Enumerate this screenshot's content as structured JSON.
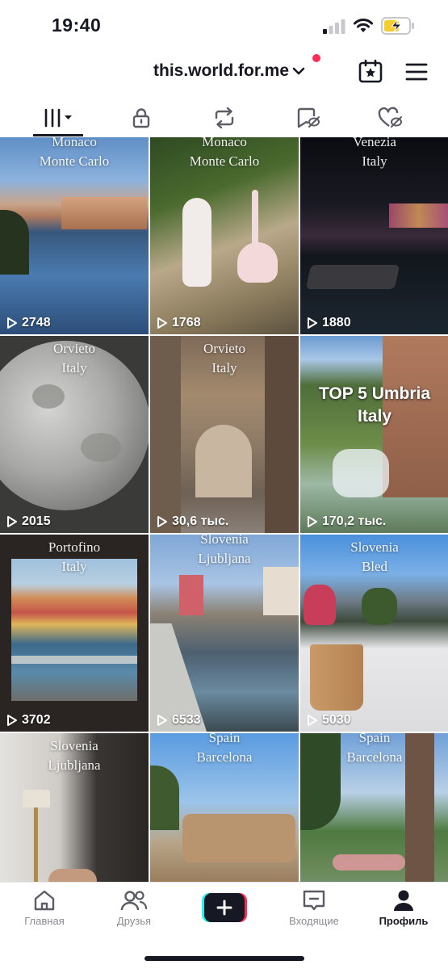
{
  "status_bar": {
    "time": "19:40"
  },
  "header": {
    "username": "this.world.for.me",
    "icons": [
      "chevron-down-icon",
      "calendar-star-icon",
      "hamburger-menu-icon"
    ],
    "accent_color": "#fe2c55"
  },
  "tabs": [
    {
      "name": "videos-grid",
      "icon": "grid-icon",
      "active": true
    },
    {
      "name": "private",
      "icon": "lock-icon",
      "active": false
    },
    {
      "name": "reposts",
      "icon": "repost-icon",
      "active": false
    },
    {
      "name": "favorites",
      "icon": "bookmark-hidden-icon",
      "active": false
    },
    {
      "name": "liked",
      "icon": "heart-hidden-icon",
      "active": false
    }
  ],
  "videos": [
    {
      "caption": "Monaco\nMonte Carlo",
      "views": "2748"
    },
    {
      "caption": "Monaco\nMonte Carlo",
      "views": "1768"
    },
    {
      "caption": "Venezia\nItaly",
      "views": "1880"
    },
    {
      "caption": "Orvieto\nItaly",
      "views": "2015"
    },
    {
      "caption": "Orvieto\nItaly",
      "views": "30,6 тыс."
    },
    {
      "caption": "TOP 5 Umbria\nItaly",
      "views": "170,2 тыс."
    },
    {
      "caption": "Portofino\nItaly",
      "views": "3702"
    },
    {
      "caption": "Slovenia\nLjubljana",
      "views": "6533"
    },
    {
      "caption": "Slovenia\nBled",
      "views": "5030"
    },
    {
      "caption": "Slovenia\nLjubljana",
      "views": ""
    },
    {
      "caption": "Spain\nBarcelona",
      "views": ""
    },
    {
      "caption": "Spain\nBarcelona",
      "views": ""
    }
  ],
  "bottom_nav": {
    "home": "Главная",
    "friends": "Друзья",
    "create": "+",
    "inbox": "Входящие",
    "profile": "Профиль"
  }
}
